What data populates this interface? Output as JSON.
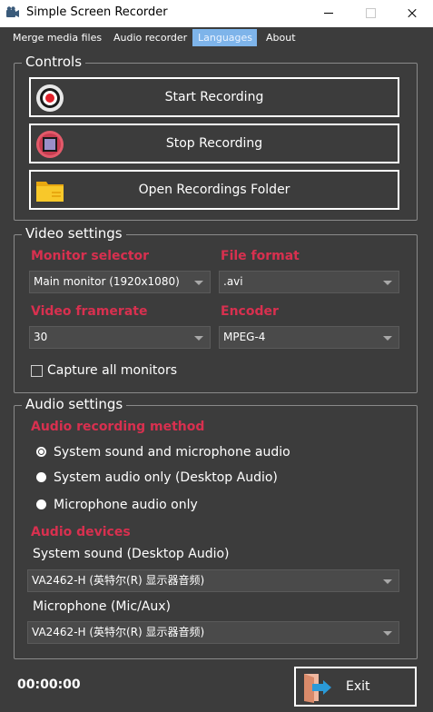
{
  "window": {
    "title": "Simple Screen Recorder"
  },
  "menu": {
    "items": [
      {
        "label": "Merge media files"
      },
      {
        "label": "Audio recorder"
      },
      {
        "label": "Languages"
      },
      {
        "label": "About"
      }
    ],
    "active": "Languages"
  },
  "controls": {
    "title": "Controls",
    "start_label": "Start Recording",
    "stop_label": "Stop Recording",
    "open_folder_label": "Open Recordings Folder"
  },
  "video": {
    "title": "Video settings",
    "monitor_label": "Monitor selector",
    "monitor_value": "Main monitor (1920x1080)",
    "format_label": "File format",
    "format_value": ".avi",
    "framerate_label": "Video framerate",
    "framerate_value": "30",
    "encoder_label": "Encoder",
    "encoder_value": "MPEG-4",
    "capture_all_label": "Capture all monitors",
    "capture_all_checked": false
  },
  "audio": {
    "title": "Audio settings",
    "method_label": "Audio recording method",
    "options": [
      {
        "label": "System sound and microphone audio",
        "selected": true
      },
      {
        "label": "System audio only (Desktop Audio)",
        "selected": false
      },
      {
        "label": "Microphone audio only",
        "selected": false
      }
    ],
    "devices_label": "Audio devices",
    "system_sound_label": "System sound (Desktop Audio)",
    "system_sound_value": "VA2462-H (英特尔(R) 显示器音频)",
    "mic_label": "Microphone (Mic/Aux)",
    "mic_value": "VA2462-H (英特尔(R) 显示器音频)"
  },
  "footer": {
    "timer": "00:00:00",
    "exit_label": "Exit"
  },
  "colors": {
    "accent_label": "#d8304f",
    "background": "#3c3c3c",
    "menu_active": "#7eb4ea"
  },
  "icons": {
    "record": "record-icon",
    "stop": "stop-icon",
    "folder": "folder-icon",
    "exit": "exit-door-icon"
  }
}
